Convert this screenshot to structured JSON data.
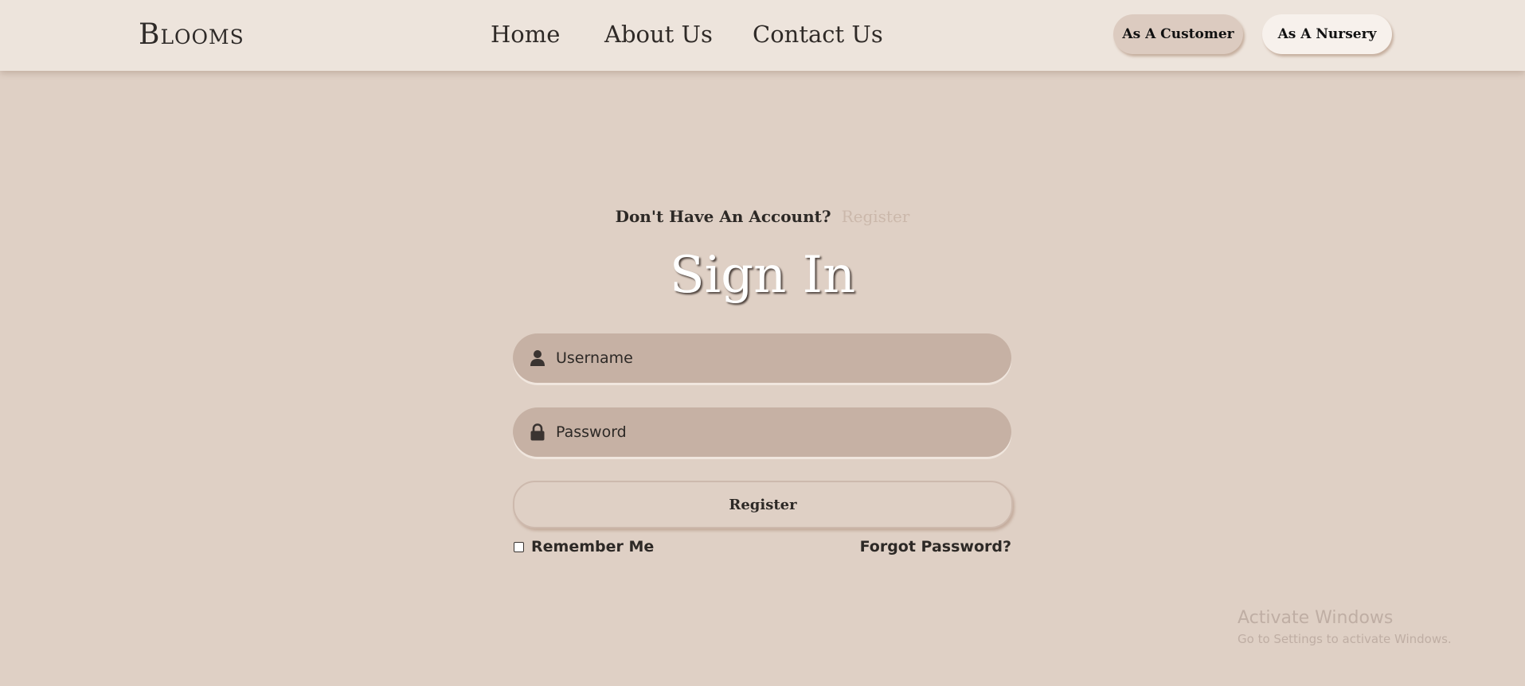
{
  "header": {
    "logo": "Blooms",
    "nav": [
      "Home",
      "About Us",
      "Contact Us"
    ],
    "buttons": {
      "customer": "As A Customer",
      "nursery": "As A Nursery"
    }
  },
  "signin": {
    "prompt": "Don't Have An Account?",
    "register_link": "Register",
    "title": "Sign In",
    "username_placeholder": "Username",
    "password_placeholder": "Password",
    "submit_label": "Register",
    "remember_label": "Remember Me",
    "forgot_label": "Forgot Password?",
    "icons": {
      "username": "user-icon",
      "password": "lock-icon"
    }
  },
  "watermark": {
    "title": "Activate Windows",
    "subtitle": "Go to Settings to activate Windows."
  },
  "colors": {
    "background": "#dfd0c5",
    "header": "#ede4dc",
    "field": "#c6b1a4",
    "register_link": "#cbb8ab"
  }
}
